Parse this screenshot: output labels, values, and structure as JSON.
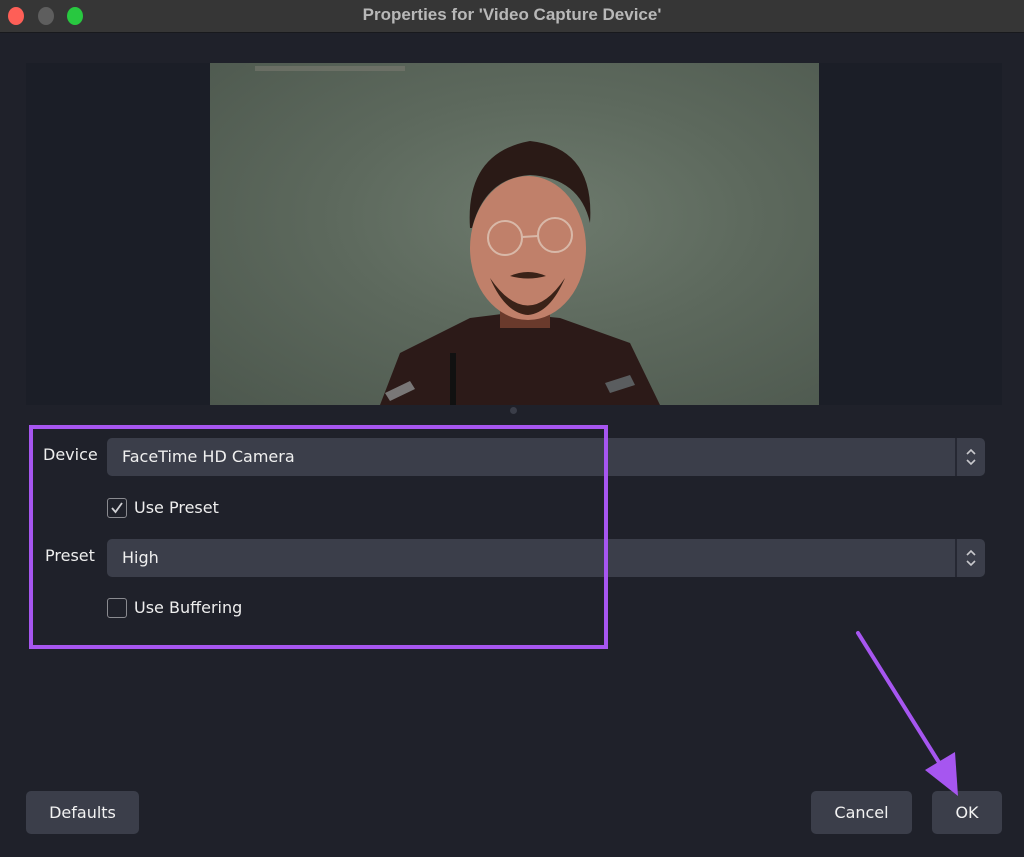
{
  "window": {
    "title": "Properties for 'Video Capture Device'",
    "controls": [
      "close",
      "minimize",
      "maximize"
    ]
  },
  "preview": {
    "description": "Live camera preview of a person wearing glasses against a green-gray wall"
  },
  "form": {
    "device": {
      "label": "Device",
      "value": "FaceTime HD Camera"
    },
    "use_preset": {
      "label": "Use Preset",
      "checked": true
    },
    "preset": {
      "label": "Preset",
      "value": "High"
    },
    "use_buffering": {
      "label": "Use Buffering",
      "checked": false
    }
  },
  "buttons": {
    "defaults": "Defaults",
    "cancel": "Cancel",
    "ok": "OK"
  },
  "annotation": {
    "color": "#a656f0",
    "highlight": "settings region",
    "arrow_target": "OK button"
  }
}
